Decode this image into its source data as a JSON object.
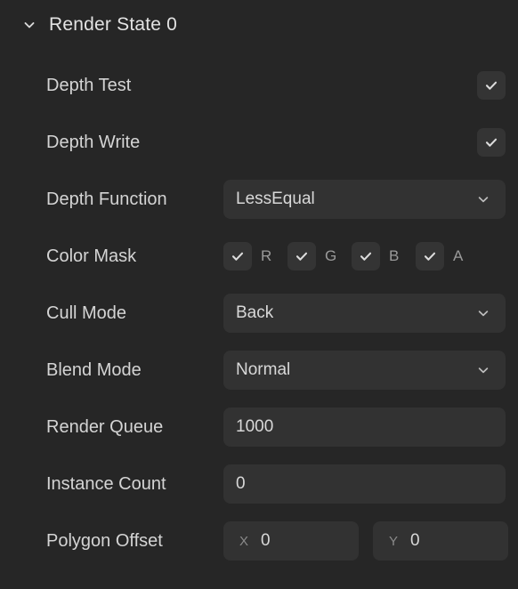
{
  "section": {
    "title": "Render State 0",
    "expanded": true,
    "toggle_icon": "chevron-down-icon"
  },
  "theme": {
    "background": "#262626",
    "field_background": "#323232",
    "control_background": "#343434",
    "label_color": "#d4d4d4",
    "value_color": "#d8d8d8",
    "muted_color": "#9a9a9a"
  },
  "rows": [
    {
      "label": "Depth Test",
      "type": "checkbox",
      "checked": true
    },
    {
      "label": "Depth Write",
      "type": "checkbox",
      "checked": true
    },
    {
      "label": "Depth Function",
      "type": "dropdown",
      "value": "LessEqual",
      "chevron_icon": "chevron-down-icon"
    },
    {
      "label": "Color Mask",
      "type": "color-mask",
      "channels": [
        {
          "label": "R",
          "checked": true
        },
        {
          "label": "G",
          "checked": true
        },
        {
          "label": "B",
          "checked": true
        },
        {
          "label": "A",
          "checked": true
        }
      ]
    },
    {
      "label": "Cull Mode",
      "type": "dropdown",
      "value": "Back",
      "chevron_icon": "chevron-down-icon"
    },
    {
      "label": "Blend Mode",
      "type": "dropdown",
      "value": "Normal",
      "chevron_icon": "chevron-down-icon"
    },
    {
      "label": "Render Queue",
      "type": "text",
      "value": "1000"
    },
    {
      "label": "Instance Count",
      "type": "text",
      "value": "0"
    },
    {
      "label": "Polygon Offset",
      "type": "vector2",
      "components": [
        {
          "axis": "X",
          "value": "0"
        },
        {
          "axis": "Y",
          "value": "0"
        }
      ]
    }
  ]
}
